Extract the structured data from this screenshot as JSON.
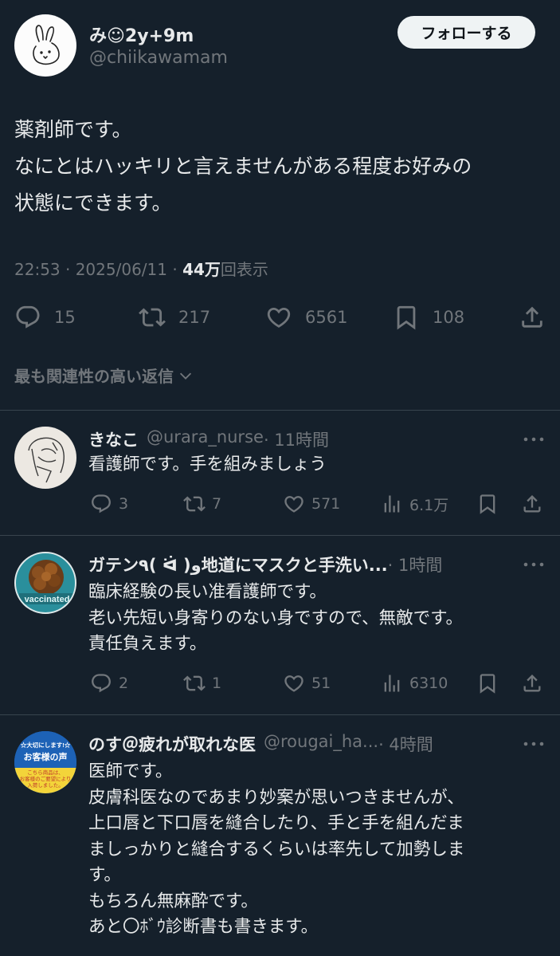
{
  "main": {
    "display_name": "み☺2y+9m",
    "handle": "@chiikawamam",
    "follow_label": "フォローする",
    "text": "薬剤師です。\nなにとはハッキリと言えませんがある程度お好みの\n状態にできます。",
    "time": "22:53 · 2025/06/11 · ",
    "views_value": "44万",
    "views_label": "回表示",
    "replies": "15",
    "reposts": "217",
    "likes": "6561",
    "bookmarks": "108"
  },
  "sort_label": "最も関連性の高い返信",
  "replies": [
    {
      "name": "きなこ",
      "handle": "@urara_nurse",
      "time": " · 11時間",
      "text": "看護師です。手を組みましょう",
      "reply_count": "3",
      "repost_count": "7",
      "like_count": "571",
      "view_count": "6.1万"
    },
    {
      "name": "ガテン٩( ᐛ )و地道にマスクと手洗い...",
      "handle": "",
      "time": " · 1時間",
      "text": "臨床経験の長い准看護師です。\n老い先短い身寄りのない身ですので、無敵です。\n責任負えます。",
      "reply_count": "2",
      "repost_count": "1",
      "like_count": "51",
      "view_count": "6310",
      "avatar_label": "vaccinated"
    },
    {
      "name": "のす＠疲れが取れな医",
      "handle": "@rougai_ha...",
      "time": " · 4時間",
      "text": "医師です。\n皮膚科医なのであまり妙案が思いつきませんが、\n上口唇と下口唇を縫合したり、手と手を組んだま\nましっかりと縫合するくらいは率先して加勢しま\nす。\nもちろん無麻酔です。\nあと〇ﾎﾞｳ診断書も書きます。",
      "avatar_lines": [
        "☆大切にします!☆",
        "お客様の声",
        "こちら商品は、",
        "お客様のご要望により",
        "入荷しました。"
      ]
    }
  ],
  "colors": {
    "background": "#15202b",
    "text": "#e7e9ea",
    "muted": "#71767b",
    "divider": "#38444d",
    "follow_bg": "#eff3f4"
  },
  "icons": [
    "reply-icon",
    "repost-icon",
    "like-icon",
    "bookmark-icon",
    "share-icon",
    "views-icon",
    "more-icon",
    "chevron-down-icon"
  ]
}
